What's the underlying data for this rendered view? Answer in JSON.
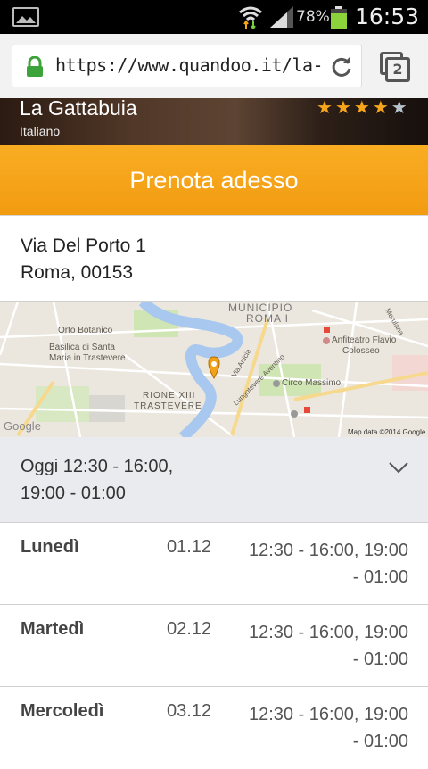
{
  "status_bar": {
    "battery": "78%",
    "time": "16:53"
  },
  "browser": {
    "url": "https://www.quandoo.it/la-ga",
    "tab_count": "2"
  },
  "restaurant": {
    "name": "La Gattabuia",
    "cuisine": "Italiano",
    "rating": 4,
    "rating_max": 5
  },
  "cta": {
    "label": "Prenota adesso"
  },
  "address": {
    "line1": "Via Del Porto 1",
    "line2": "Roma, 00153"
  },
  "map": {
    "labels": {
      "municipio": "MUNICIPIO",
      "roma": "ROMA I",
      "orto": "Orto Botanico",
      "basilica1": "Basilica di Santa",
      "basilica2": "Maria in Trastevere",
      "rione": "RIONE XIII",
      "trastevere": "TRASTEVERE",
      "anfiteatro1": "Anfiteatro Flavio",
      "anfiteatro2": "Colosseo",
      "circo": "Circo Massimo",
      "via_anicia": "Via Anicia",
      "lungotevere": "Lungotevere Aventino",
      "merulana": "Merulana",
      "google": "Google",
      "map_data": "Map data ©2014 Google"
    }
  },
  "hours": {
    "today_line1": "Oggi 12:30 - 16:00,",
    "today_line2": "19:00 - 01:00",
    "days": [
      {
        "day": "Lunedì",
        "date": "01.12",
        "line1": "12:30 - 16:00, 19:00",
        "line2": "- 01:00"
      },
      {
        "day": "Martedì",
        "date": "02.12",
        "line1": "12:30 - 16:00, 19:00",
        "line2": "- 01:00"
      },
      {
        "day": "Mercoledì",
        "date": "03.12",
        "line1": "12:30 - 16:00, 19:00",
        "line2": "- 01:00"
      }
    ]
  },
  "colors": {
    "accent": "#f7a51c",
    "cta": "#f4a217",
    "river": "#a8c8ef"
  }
}
